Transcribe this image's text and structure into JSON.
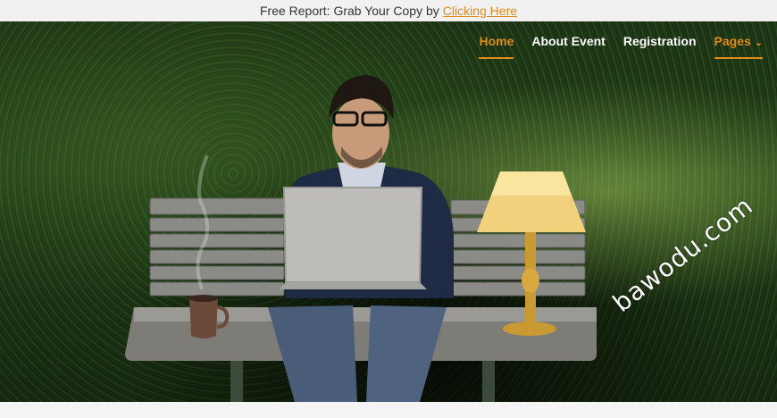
{
  "topbar": {
    "text": "Free Report: Grab Your Copy by",
    "link_label": "Clicking Here"
  },
  "nav": {
    "items": [
      {
        "label": "Home",
        "active": true
      },
      {
        "label": "About Event",
        "active": false
      },
      {
        "label": "Registration",
        "active": false
      },
      {
        "label": "Pages",
        "active": true,
        "has_dropdown": true
      }
    ]
  },
  "hero": {
    "image_description_icon": "man-on-bench-laptop-image",
    "watermark": "bawodu.com"
  },
  "colors": {
    "accent": "#e08a1e",
    "topbar_bg": "#f1f1f1"
  }
}
